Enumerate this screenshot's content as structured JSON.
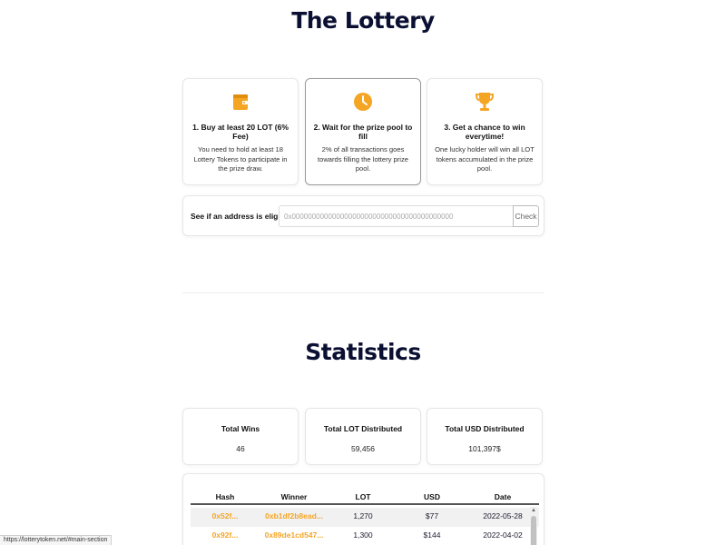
{
  "lottery": {
    "title": "The Lottery",
    "steps": [
      {
        "title": "1. Buy at least 20 LOT (6% Fee)",
        "desc": "You need to hold at least 18 Lottery Tokens to participate in the prize draw.",
        "icon": "wallet-icon"
      },
      {
        "title": "2. Wait for the prize pool to fill",
        "desc": "2% of all transactions goes towards filling the lottery prize pool.",
        "icon": "clock-icon"
      },
      {
        "title": "3. Get a chance to win everytime!",
        "desc": "One lucky holder will win all LOT tokens accumulated in the prize pool.",
        "icon": "trophy-icon"
      }
    ],
    "eligibility": {
      "label": "See if an address is eligible:",
      "placeholder": "0x0000000000000000000000000000000000000000",
      "button": "Check"
    }
  },
  "statistics": {
    "title": "Statistics",
    "cards": [
      {
        "label": "Total Wins",
        "value": "46"
      },
      {
        "label": "Total LOT Distributed",
        "value": "59,456"
      },
      {
        "label": "Total USD Distributed",
        "value": "101,397$"
      }
    ],
    "table": {
      "columns": [
        "Hash",
        "Winner",
        "LOT",
        "USD",
        "Date"
      ],
      "rows": [
        {
          "hash": "0x52f...",
          "winner": "0xb1df2b8ead...",
          "lot": "1,270",
          "usd": "$77",
          "date": "2022-05-28"
        },
        {
          "hash": "0x92f...",
          "winner": "0x89de1cd547...",
          "lot": "1,300",
          "usd": "$144",
          "date": "2022-04-02"
        }
      ]
    }
  },
  "status_bar": {
    "url": "https://lotterytoken.net/#main-section"
  },
  "colors": {
    "accent": "#f5a524",
    "heading": "#0b1033"
  }
}
